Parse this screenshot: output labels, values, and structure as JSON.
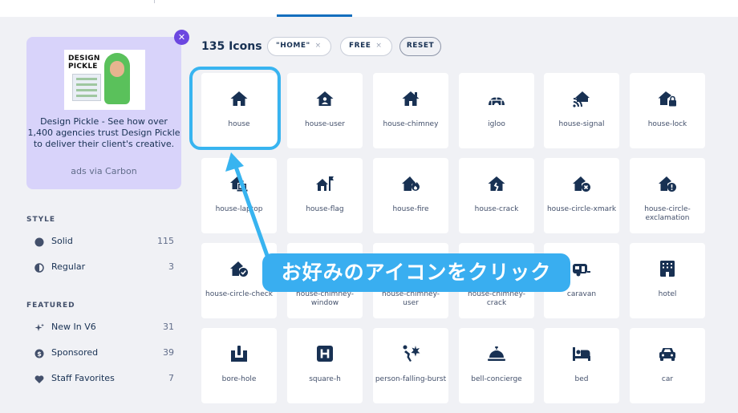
{
  "ad": {
    "close_icon": "close-icon",
    "image_brand_line1": "DESIGN",
    "image_brand_line2": "PICKLE",
    "text": "Design Pickle - See how over 1,400 agencies trust Design Pickle to deliver their client's creative.",
    "via": "ads via Carbon"
  },
  "sidebar": {
    "style_title": "STYLE",
    "style_items": [
      {
        "label": "Solid",
        "count": "115",
        "icon": "circle-solid-icon"
      },
      {
        "label": "Regular",
        "count": "3",
        "icon": "circle-half-icon"
      }
    ],
    "featured_title": "FEATURED",
    "featured_items": [
      {
        "label": "New In V6",
        "count": "31",
        "icon": "sparkles-icon"
      },
      {
        "label": "Sponsored",
        "count": "39",
        "icon": "dollar-circle-icon"
      },
      {
        "label": "Staff Favorites",
        "count": "7",
        "icon": "heart-icon"
      }
    ]
  },
  "header": {
    "count_label": "135 Icons",
    "filters": [
      {
        "label": "\"HOME\"",
        "remove": "×"
      },
      {
        "label": "FREE",
        "remove": "×"
      }
    ],
    "reset_label": "RESET"
  },
  "icons": [
    {
      "name": "house"
    },
    {
      "name": "house-user"
    },
    {
      "name": "house-chimney"
    },
    {
      "name": "igloo"
    },
    {
      "name": "house-signal"
    },
    {
      "name": "house-lock"
    },
    {
      "name": "house-laptop"
    },
    {
      "name": "house-flag"
    },
    {
      "name": "house-fire"
    },
    {
      "name": "house-crack"
    },
    {
      "name": "house-circle-xmark"
    },
    {
      "name": "house-circle-exclamation"
    },
    {
      "name": "house-circle-check"
    },
    {
      "name": "house-chimney-window"
    },
    {
      "name": "house-chimney-user"
    },
    {
      "name": "house-chimney-crack"
    },
    {
      "name": "caravan"
    },
    {
      "name": "hotel"
    },
    {
      "name": "bore-hole"
    },
    {
      "name": "square-h"
    },
    {
      "name": "person-falling-burst"
    },
    {
      "name": "bell-concierge"
    },
    {
      "name": "bed"
    },
    {
      "name": "car"
    }
  ],
  "annotation": {
    "callout_text": "お好みのアイコンをクリック"
  },
  "colors": {
    "accent": "#146ebe",
    "highlight": "#38b4f0",
    "icon": "#183153",
    "ad_bg": "#d8d3fa",
    "close": "#6c47e0"
  }
}
